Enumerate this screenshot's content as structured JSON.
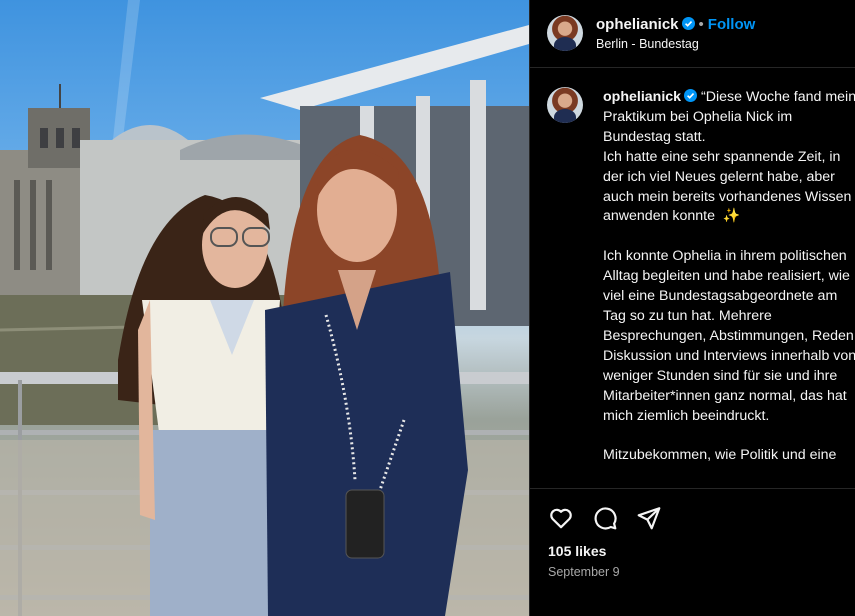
{
  "post": {
    "username": "ophelianick",
    "separator": "•",
    "follow_label": "Follow",
    "location": "Berlin - Bundestag",
    "caption": "“Diese Woche fand mein Praktikum bei Ophelia Nick im Bundestag statt.\nIch hatte eine sehr spannende Zeit, in der ich viel Neues gelernt habe, aber auch mein bereits vorhandenes Wissen anwenden konnte  ✨\n\nIch konnte Ophelia in ihrem politischen Alltag begleiten und habe realisiert, wie viel eine Bundestagsabgeordnete am Tag so zu tun hat. Mehrere Besprechungen, Abstimmungen, Reden, Diskussion und Interviews innerhalb von weniger Stunden sind für sie und ihre Mitarbeiter*innen ganz normal, das hat mich ziemlich beeindruckt.\n\nMitzubekommen, wie Politik und eine",
    "likes": "105 likes",
    "date": "September 9"
  },
  "icons": {
    "verified": "verified-badge-icon",
    "like": "heart-icon",
    "comment": "comment-icon",
    "share": "paper-plane-icon"
  },
  "colors": {
    "accent": "#0095f6",
    "background": "#000000",
    "text": "#f5f5f5",
    "muted": "#a8a8a8"
  }
}
